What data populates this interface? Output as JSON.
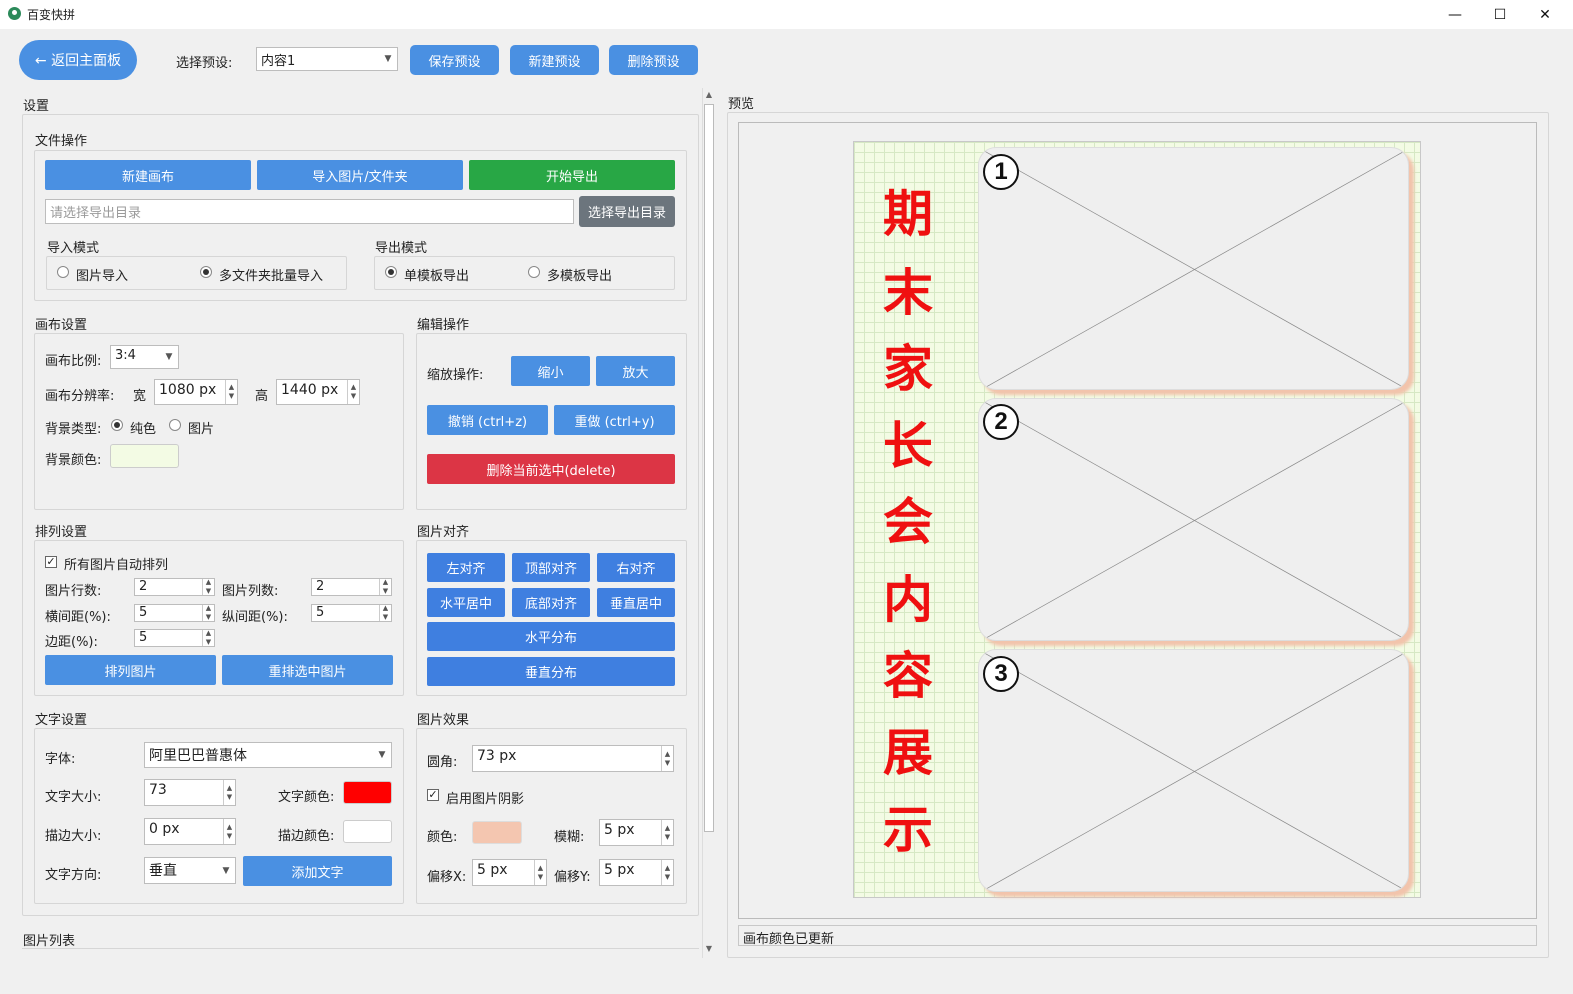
{
  "window": {
    "title": "百变快拼",
    "min": "—",
    "max": "☐",
    "close": "✕"
  },
  "toolbar": {
    "back": "← 返回主面板",
    "preset_label": "选择预设:",
    "preset_value": "内容1",
    "save": "保存预设",
    "new": "新建预设",
    "delete": "删除预设"
  },
  "settings": {
    "title": "设置",
    "file_ops": {
      "title": "文件操作",
      "new_canvas": "新建画布",
      "import": "导入图片/文件夹",
      "export": "开始导出",
      "export_dir_placeholder": "请选择导出目录",
      "choose_dir": "选择导出目录",
      "import_mode": "导入模式",
      "import_image": "图片导入",
      "import_multi": "多文件夹批量导入",
      "export_mode": "导出模式",
      "export_single": "单模板导出",
      "export_multi": "多模板导出"
    },
    "canvas": {
      "title": "画布设置",
      "ratio_label": "画布比例:",
      "ratio": "3:4",
      "res_label": "画布分辨率:",
      "w_label": "宽",
      "w": "1080 px",
      "h_label": "高",
      "h": "1440 px",
      "bg_type": "背景类型:",
      "solid": "纯色",
      "image": "图片",
      "bg_color": "背景颜色:",
      "bg_color_value": "#f3fbe4"
    },
    "edit": {
      "title": "编辑操作",
      "zoom_label": "缩放操作:",
      "zoom_out": "缩小",
      "zoom_in": "放大",
      "undo": "撤销 (ctrl+z)",
      "redo": "重做 (ctrl+y)",
      "delete_sel": "删除当前选中(delete)"
    },
    "arrange": {
      "title": "排列设置",
      "auto": "所有图片自动排列",
      "rows_label": "图片行数:",
      "rows": "2",
      "cols_label": "图片列数:",
      "cols": "2",
      "hgap_label": "横间距(%):",
      "hgap": "5",
      "vgap_label": "纵间距(%):",
      "vgap": "5",
      "margin_label": "边距(%):",
      "margin": "5",
      "arrange_btn": "排列图片",
      "rearrange_btn": "重排选中图片"
    },
    "align": {
      "title": "图片对齐",
      "left": "左对齐",
      "top": "顶部对齐",
      "right": "右对齐",
      "hcenter": "水平居中",
      "bottom": "底部对齐",
      "vcenter": "垂直居中",
      "hdist": "水平分布",
      "vdist": "垂直分布"
    },
    "text": {
      "title": "文字设置",
      "font_label": "字体:",
      "font": "阿里巴巴普惠体",
      "size_label": "文字大小:",
      "size": "73",
      "color_label": "文字颜色:",
      "color": "#ff0000",
      "stroke_label": "描边大小:",
      "stroke": "0 px",
      "stroke_color_label": "描边颜色:",
      "stroke_color": "#ffffff",
      "dir_label": "文字方向:",
      "dir": "垂直",
      "add_btn": "添加文字"
    },
    "effects": {
      "title": "图片效果",
      "radius_label": "圆角:",
      "radius": "73 px",
      "shadow": "启用图片阴影",
      "color_label": "颜色:",
      "shadow_color": "#f4c6b0",
      "blur_label": "模糊:",
      "blur": "5 px",
      "ox_label": "偏移X:",
      "ox": "5 px",
      "oy_label": "偏移Y:",
      "oy": "5 px"
    },
    "image_list": "图片列表"
  },
  "preview": {
    "title": "预览",
    "canvas_text": [
      "期",
      "末",
      "家",
      "长",
      "会",
      "内",
      "容",
      "展",
      "示"
    ],
    "slots": [
      "1",
      "2",
      "3"
    ],
    "status": "画布颜色已更新"
  }
}
